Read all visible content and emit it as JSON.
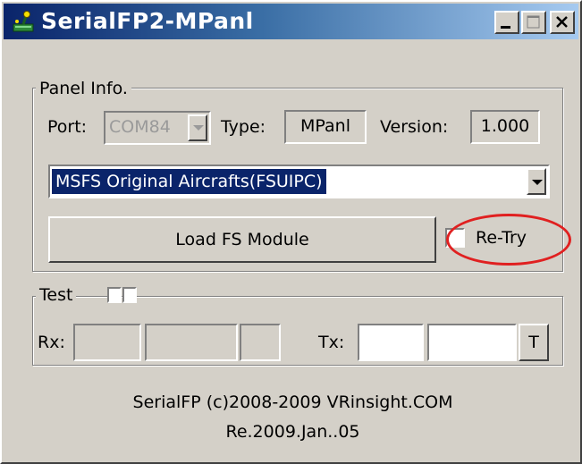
{
  "window": {
    "title": "SerialFP2-MPanl",
    "controls": {
      "minimize": "minimize",
      "maximize": "maximize",
      "close": "close"
    }
  },
  "panel_info": {
    "legend": "Panel Info.",
    "port_label": "Port:",
    "port_value": "COM84",
    "type_label": "Type:",
    "type_value": "MPanl",
    "version_label": "Version:",
    "version_value": "1.000",
    "aircraft_selected": "MSFS Original Aircrafts(FSUIPC)",
    "load_button": "Load FS Module",
    "retry_label": "Re-Try",
    "retry_checked": false
  },
  "test": {
    "legend": "Test",
    "rx_label": "Rx:",
    "tx_label": "Tx:",
    "t_button": "T"
  },
  "footer": {
    "line1": "SerialFP (c)2008-2009 VRinsight.COM",
    "line2": "Re.2009.Jan..05"
  },
  "colors": {
    "face": "#d4d0c8",
    "title_start": "#0a246a",
    "title_end": "#a6caf0",
    "selection": "#0a246a",
    "annotation": "#e02020"
  },
  "icons": {
    "app": "joystick-icon",
    "minimize": "minimize-icon",
    "maximize": "maximize-icon",
    "close": "close-icon",
    "dropdown": "chevron-down-icon"
  }
}
